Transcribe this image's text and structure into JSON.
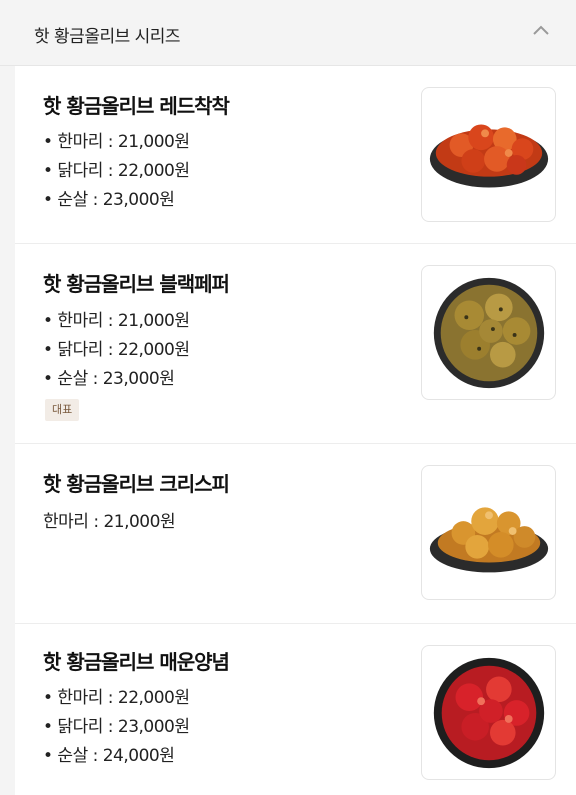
{
  "header": {
    "title": "핫 황금올리브 시리즈"
  },
  "items": [
    {
      "name": "핫 황금올리브 레드착착",
      "prices": [
        "• 한마리 : 21,000원",
        "• 닭다리 : 22,000원",
        "• 순살 : 23,000원"
      ],
      "image": "red-sauce-chicken"
    },
    {
      "name": "핫 황금올리브 블랙페퍼",
      "prices": [
        "• 한마리 : 21,000원",
        "• 닭다리 : 22,000원",
        "• 순살 : 23,000원"
      ],
      "badge": "대표",
      "image": "black-pepper-chicken"
    },
    {
      "name": "핫 황금올리브 크리스피",
      "prices": [
        "한마리 : 21,000원"
      ],
      "image": "crispy-fried-chicken"
    },
    {
      "name": "핫 황금올리브 매운양념",
      "prices": [
        "• 한마리 : 22,000원",
        "• 닭다리 : 23,000원",
        "• 순살 : 24,000원"
      ],
      "image": "spicy-seasoned-chicken"
    }
  ],
  "colors": {
    "red_sauce": "#d9461c",
    "black_pepper": "#a88a34",
    "crispy": "#d9952f",
    "spicy": "#d8222a",
    "plate": "#2b2b2b"
  }
}
